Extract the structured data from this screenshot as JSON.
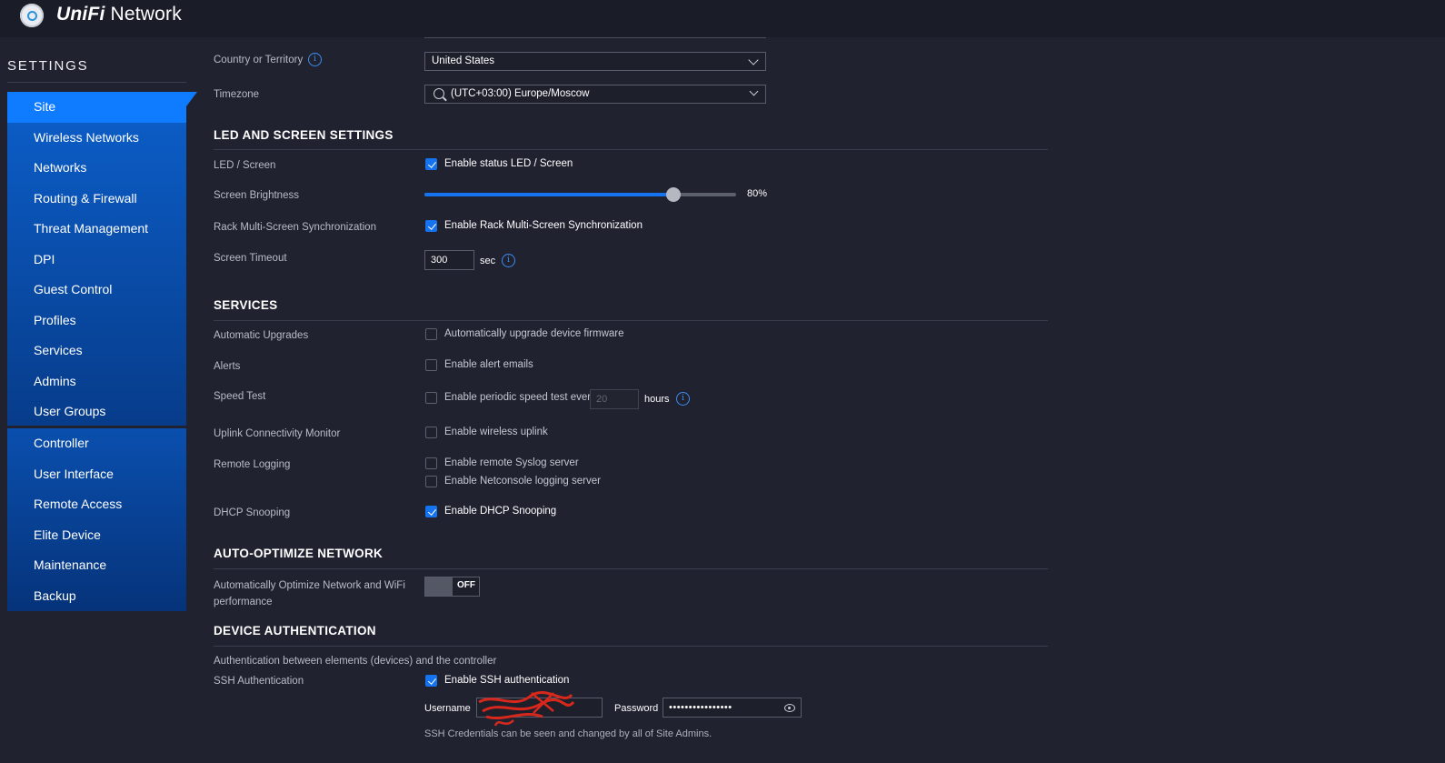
{
  "header": {
    "brand_unifi": "UniFi",
    "brand_network": "Network"
  },
  "sidebar": {
    "title": "SETTINGS",
    "group1": [
      "Site",
      "Wireless Networks",
      "Networks",
      "Routing & Firewall",
      "Threat Management",
      "DPI",
      "Guest Control",
      "Profiles",
      "Services",
      "Admins",
      "User Groups"
    ],
    "group2": [
      "Controller",
      "User Interface",
      "Remote Access",
      "Elite Device",
      "Maintenance",
      "Backup"
    ],
    "active": "Site"
  },
  "site": {
    "country_label": "Country or Territory",
    "country_value": "United States",
    "timezone_label": "Timezone",
    "timezone_value": "(UTC+03:00) Europe/Moscow"
  },
  "led": {
    "heading": "LED AND SCREEN SETTINGS",
    "led_label": "LED / Screen",
    "led_cb": "Enable status LED / Screen",
    "brightness_label": "Screen Brightness",
    "brightness_value": "80%",
    "brightness_level": 0.8,
    "rack_label": "Rack Multi-Screen Synchronization",
    "rack_cb": "Enable Rack Multi-Screen Synchronization",
    "timeout_label": "Screen Timeout",
    "timeout_value": "300",
    "timeout_unit": "sec"
  },
  "services": {
    "heading": "SERVICES",
    "upgrades_label": "Automatic Upgrades",
    "upgrades_cb": "Automatically upgrade device firmware",
    "alerts_label": "Alerts",
    "alerts_cb": "Enable alert emails",
    "speed_label": "Speed Test",
    "speed_cb": "Enable periodic speed test every",
    "speed_value": "20",
    "speed_unit": "hours",
    "uplink_label": "Uplink Connectivity Monitor",
    "uplink_cb": "Enable wireless uplink",
    "logging_label": "Remote Logging",
    "syslog_cb": "Enable remote Syslog server",
    "netconsole_cb": "Enable Netconsole logging server",
    "dhcp_label": "DHCP Snooping",
    "dhcp_cb": "Enable DHCP Snooping"
  },
  "auto": {
    "heading": "AUTO-OPTIMIZE NETWORK",
    "label_line1": "Automatically Optimize Network and WiFi",
    "label_line2": "performance",
    "toggle": "OFF"
  },
  "auth": {
    "heading": "DEVICE AUTHENTICATION",
    "desc": "Authentication between elements (devices) and the controller",
    "ssh_label": "SSH Authentication",
    "ssh_cb": "Enable SSH authentication",
    "username_label": "Username",
    "password_label": "Password",
    "password_value": "••••••••••••••••",
    "note": "SSH Credentials can be seen and changed by all of Site Admins."
  },
  "colors": {
    "accent": "#1673f0",
    "sidebar_active": "#0f7bff",
    "background": "#202230"
  }
}
